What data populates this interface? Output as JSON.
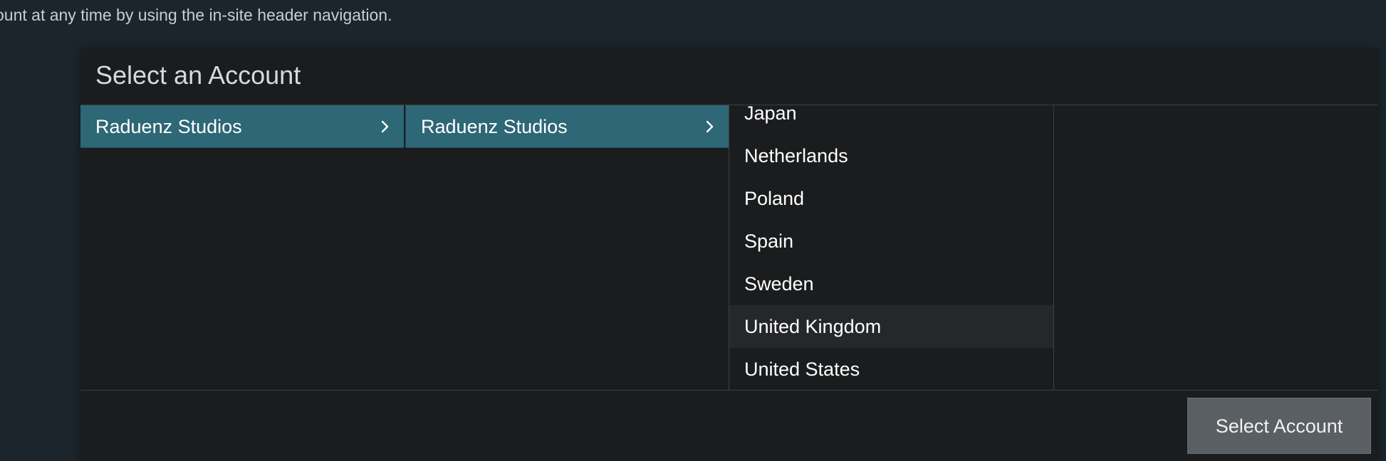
{
  "intro": {
    "text": "ount at any time by using the in-site header navigation."
  },
  "dialog": {
    "title": "Select an Account",
    "columns": [
      {
        "selected": "Raduenz Studios"
      },
      {
        "selected": "Raduenz Studios"
      }
    ],
    "countries": [
      {
        "label": "Japan"
      },
      {
        "label": "Netherlands"
      },
      {
        "label": "Poland"
      },
      {
        "label": "Spain"
      },
      {
        "label": "Sweden"
      },
      {
        "label": "United Kingdom"
      },
      {
        "label": "United States"
      }
    ],
    "hovered_item": "United Kingdom",
    "select_button": "Select Account"
  },
  "colors": {
    "page_bg": "#1b252b",
    "panel_bg": "#1b1c1e",
    "selected_bg": "#2e6776",
    "hover_bg": "#25272a",
    "button_bg": "#5a5f63"
  },
  "icons": {
    "chevron": "chevron-right-icon"
  }
}
